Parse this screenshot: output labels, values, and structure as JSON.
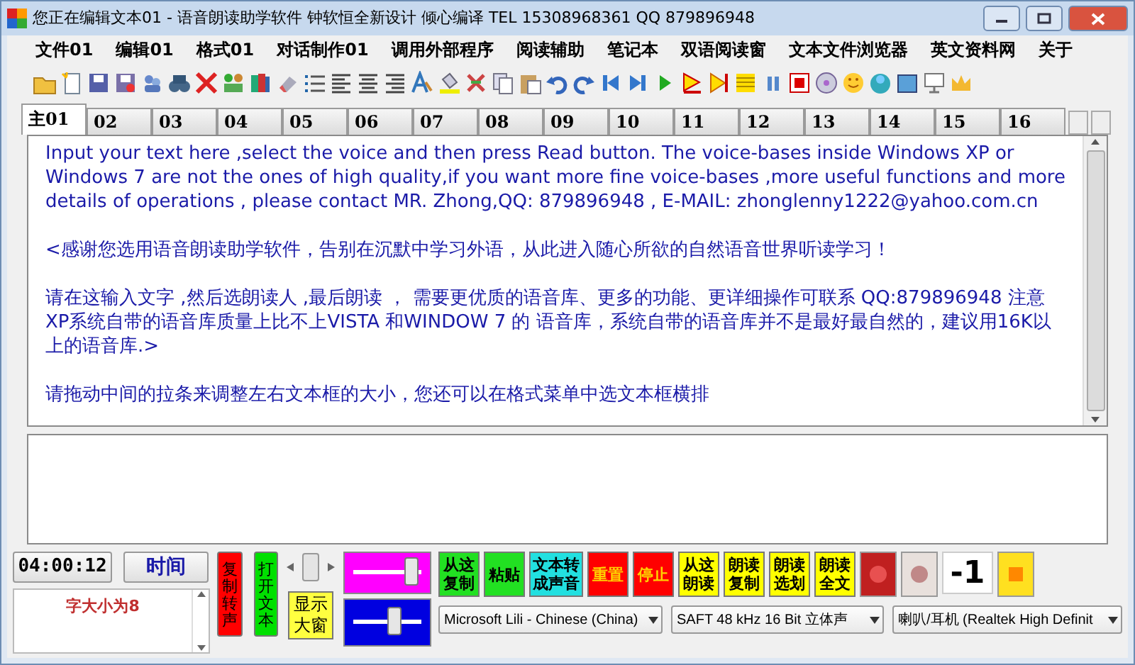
{
  "window": {
    "title": "您正在编辑文本01 - 语音朗读助学软件 钟软恒全新设计 倾心编译 TEL 15308968361 QQ 879896948"
  },
  "menu": [
    "文件01",
    "编辑01",
    "格式01",
    "对话制作01",
    "调用外部程序",
    "阅读辅助",
    "笔记本",
    "双语阅读窗",
    "文本文件浏览器",
    "英文资料网",
    "关于"
  ],
  "tabs": [
    {
      "label": "主01",
      "selected": true
    },
    {
      "label": "02",
      "selected": false
    },
    {
      "label": "03",
      "selected": false
    },
    {
      "label": "04",
      "selected": false
    },
    {
      "label": "05",
      "selected": false
    },
    {
      "label": "06",
      "selected": false
    },
    {
      "label": "07",
      "selected": false
    },
    {
      "label": "08",
      "selected": false
    },
    {
      "label": "09",
      "selected": false
    },
    {
      "label": "10",
      "selected": false
    },
    {
      "label": "11",
      "selected": false
    },
    {
      "label": "12",
      "selected": false
    },
    {
      "label": "13",
      "selected": false
    },
    {
      "label": "14",
      "selected": false
    },
    {
      "label": "15",
      "selected": false
    },
    {
      "label": "16",
      "selected": false
    }
  ],
  "editor": {
    "paragraphs": [
      "Input your text here ,select the voice and then press Read button. The voice-bases inside Windows XP or Windows 7 are not the ones of high quality,if you want more fine voice-bases ,more useful functions and more details of operations , please contact  MR. Zhong,QQ: 879896948 , E-MAIL:  zhonglenny1222@yahoo.com.cn",
      "<感谢您选用语音朗读助学软件，告别在沉默中学习外语，从此进入随心所欲的自然语音世界听读学习！",
      "请在这输入文字 ,然后选朗读人 ,最后朗读 ， 需要更优质的语音库、更多的功能、更详细操作可联系 QQ:879896948   注意XP系统自带的语音库质量上比不上VISTA 和WINDOW 7 的 语音库，系统自带的语音库并不是最好最自然的，建议用16K以上的语音库.>",
      "请拖动中间的拉条来调整左右文本框的大小，您还可以在格式菜单中选文本框横排"
    ]
  },
  "bottom": {
    "time_display": "04:00:12",
    "time_button": "时间",
    "font_size_label": "字大小为8",
    "side_buttons": [
      {
        "label": "复制转声",
        "color": "#ff0000"
      },
      {
        "label": "打开文本",
        "color": "#00e000"
      }
    ],
    "big_window_button": "显示大窗",
    "sliders": [
      {
        "color": "#ff00ff",
        "level": 0.85
      },
      {
        "color": "#0000e0",
        "level": 0.6
      }
    ],
    "buttons": [
      {
        "label": "从这复制",
        "color": "#22e022"
      },
      {
        "label": "粘贴",
        "color": "#22e022"
      },
      {
        "label": "文本转成声音",
        "color": "#22e0e0"
      },
      {
        "label": "重置",
        "color": "#ff0000"
      },
      {
        "label": "停止",
        "color": "#ff0000"
      },
      {
        "label": "从这朗读",
        "color": "#ffff00"
      },
      {
        "label": "朗读复制",
        "color": "#ffff00"
      },
      {
        "label": "朗读选划",
        "color": "#ffff00"
      },
      {
        "label": "朗读全文",
        "color": "#ffff00"
      }
    ],
    "counter": "-1",
    "dropdowns": [
      {
        "value": "Microsoft Lili - Chinese (China)"
      },
      {
        "value": "SAFT 48 kHz 16 Bit 立体声"
      },
      {
        "value": "喇叭/耳机 (Realtek High Definit"
      }
    ]
  }
}
